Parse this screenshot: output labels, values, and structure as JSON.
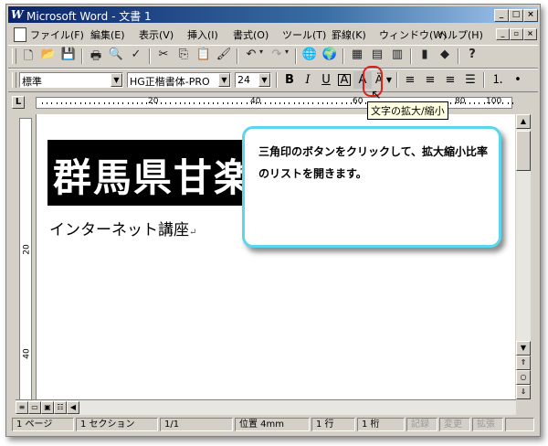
{
  "window": {
    "title": "Microsoft Word - 文書 1",
    "app_icon": "W"
  },
  "menu": {
    "items": [
      "ファイル(F)",
      "編集(E)",
      "表示(V)",
      "挿入(I)",
      "書式(O)",
      "ツール(T)",
      "罫線(K)",
      "ウィンドウ(W)",
      "ヘルプ(H)"
    ]
  },
  "formatting": {
    "style": "標準",
    "font": "HG正楷書体-PRO",
    "size": "24",
    "bold": "B",
    "italic": "I",
    "underline": "U",
    "border_char": "A",
    "shade_char": "A"
  },
  "ruler": {
    "labels": [
      "20",
      "40",
      "60",
      "80",
      "100"
    ],
    "vlabels": [
      "20",
      "40"
    ]
  },
  "document": {
    "heading": "群馬県甘楽",
    "subline": "インターネット講座",
    "paragraph_mark": "↵"
  },
  "tooltip": "文字の拡大/縮小",
  "callout": {
    "text": "三角印のボタンをクリックして、拡大縮小比率のリストを開きます。"
  },
  "status": {
    "page": "1 ページ",
    "section": "1 セクション",
    "pages": "1/1",
    "position": "位置 4mm",
    "line": "1 行",
    "column": "1 桁",
    "rec": "記録",
    "trk": "変更",
    "ext": "拡張"
  },
  "icons": [
    "new-icon",
    "open-icon",
    "save-icon",
    "print-icon",
    "preview-icon",
    "spell-icon",
    "cut-icon",
    "copy-icon",
    "paste-icon",
    "format-painter-icon",
    "undo-icon",
    "redo-icon",
    "hyperlink-icon",
    "web-icon",
    "tables-icon",
    "insert-table-icon",
    "excel-icon",
    "columns-icon",
    "drawing-icon",
    "help-icon"
  ],
  "colors": {
    "title_start": "#0a246a",
    "callout_border": "#5bd6ec",
    "highlight": "#e0201a"
  }
}
